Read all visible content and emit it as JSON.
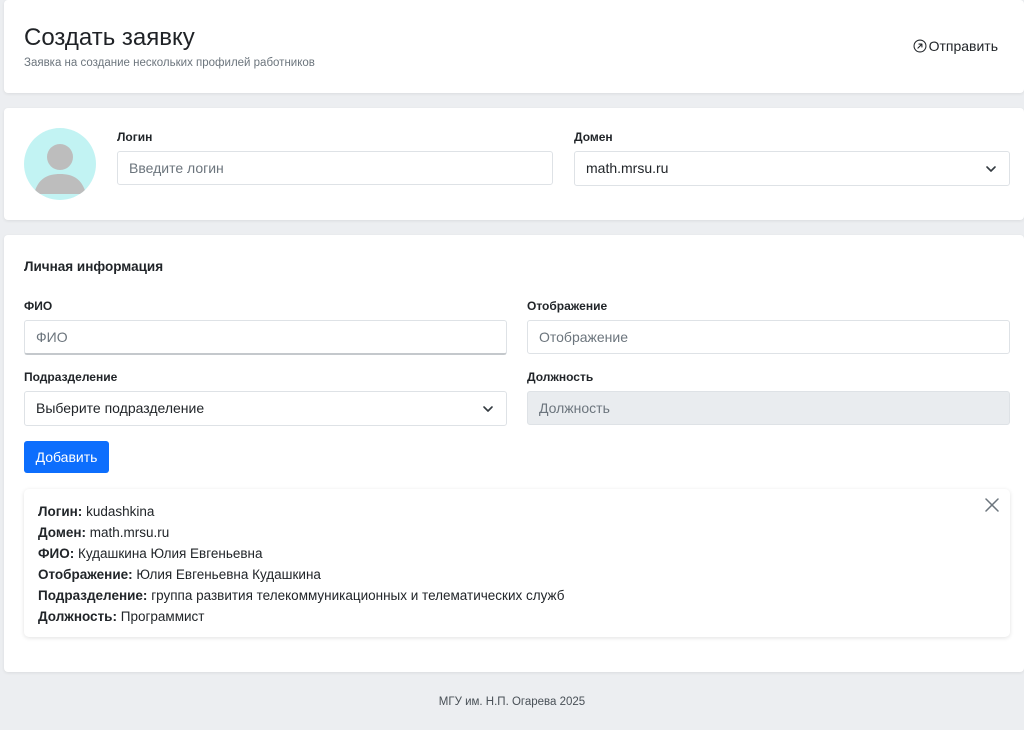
{
  "header": {
    "title": "Создать заявку",
    "subtitle": "Заявка на создание нескольких профилей работников",
    "send_label": "Отправить"
  },
  "account": {
    "login_label": "Логин",
    "login_placeholder": "Введите логин",
    "domain_label": "Домен",
    "domain_value": "math.mrsu.ru"
  },
  "personal": {
    "section_title": "Личная информация",
    "fio_label": "ФИО",
    "fio_placeholder": "ФИО",
    "display_label": "Отображение",
    "display_placeholder": "Отображение",
    "department_label": "Подразделение",
    "department_placeholder": "Выберите подразделение",
    "position_label": "Должность",
    "position_placeholder": "Должность",
    "add_label": "Добавить"
  },
  "entry": {
    "login_key": "Логин:",
    "login_value": "kudashkina",
    "domain_key": "Домен:",
    "domain_value": "math.mrsu.ru",
    "fio_key": "ФИО:",
    "fio_value": "Кудашкина Юлия Евгеньевна",
    "display_key": "Отображение:",
    "display_value": "Юлия Евгеньевна Кудашкина",
    "department_key": "Подразделение:",
    "department_value": "группа развития телекоммуникационных и телематических служб",
    "position_key": "Должность:",
    "position_value": "Программист"
  },
  "footer": {
    "text": "МГУ им. Н.П. Огарева 2025"
  },
  "colors": {
    "primary": "#0d6efd",
    "avatar_bg": "#c2f3f3",
    "page_bg": "#eceef1"
  },
  "icons": [
    "arrow-up-right-circle-icon",
    "chevron-down-icon",
    "close-icon",
    "user-avatar-icon"
  ]
}
